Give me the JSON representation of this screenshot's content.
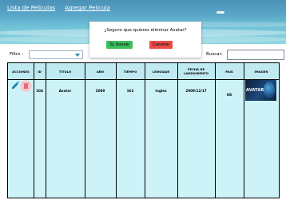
{
  "nav": {
    "list_label": "Lista de Peliculas",
    "add_label": "Agregar Pelicula"
  },
  "filter": {
    "label": "Filtro :",
    "selected": ""
  },
  "search": {
    "label": "Buscar:",
    "value": ""
  },
  "table": {
    "headers": [
      "ACCIONES",
      "ID",
      "TITULO",
      "AÑO",
      "TIEMPO",
      "LENGUAJE",
      "FECHA DE LANZAMIENTO",
      "PAIS",
      "IMAGEN"
    ],
    "rows": [
      {
        "id": "104",
        "title": "Avatar",
        "year": "2009",
        "time": "162",
        "language": "ingles",
        "release": "2009/12/17",
        "country": "UK",
        "poster_text": "AVATAR"
      }
    ]
  },
  "modal": {
    "question": "¿Seguro que quieres eliminar Avatar?",
    "confirm_label": "Si, borralo",
    "cancel_label": "Cancelar"
  },
  "colors": {
    "confirm": "#3bbf5c",
    "cancel": "#ea4c46",
    "table_bg": "#cdf3f9",
    "edit_icon": "#1f7fb0",
    "trash_icon": "#e88f98"
  },
  "icons": [
    "edit-icon",
    "trash-icon",
    "dropdown-caret-icon"
  ]
}
